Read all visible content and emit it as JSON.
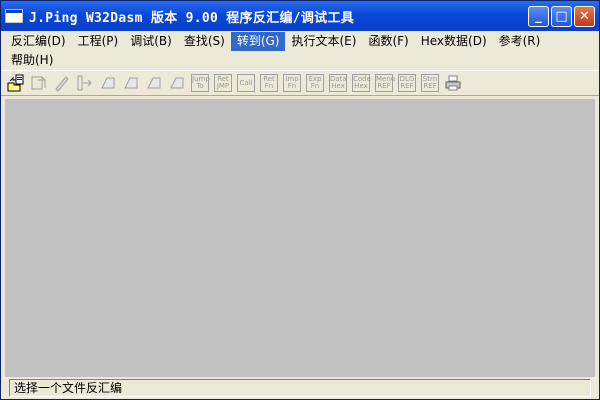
{
  "window": {
    "title": "J.Ping W32Dasm 版本 9.00 程序反汇编/调试工具",
    "buttons": {
      "minimize": "_",
      "maximize": "□",
      "close": "✕"
    }
  },
  "menu": [
    {
      "label": "反汇编(D)"
    },
    {
      "label": "工程(P)"
    },
    {
      "label": "调试(B)"
    },
    {
      "label": "查找(S)"
    },
    {
      "label": "转到(G)",
      "active": true
    },
    {
      "label": "执行文本(E)"
    },
    {
      "label": "函数(F)"
    },
    {
      "label": "Hex数据(D)"
    },
    {
      "label": "参考(R)"
    },
    {
      "label": "帮助(H)"
    }
  ],
  "toolbar": {
    "text_buttons": {
      "jump_to": [
        "Jump",
        "To"
      ],
      "ret_jmp": [
        "Ret",
        "JMP"
      ],
      "call": [
        "Call",
        ""
      ],
      "ret_fn": [
        "Ret",
        "Fn"
      ],
      "imp_fn": [
        "Imp",
        "Fn"
      ],
      "exp_fn": [
        "Exp",
        "Fn"
      ],
      "data_hex": [
        "Data",
        "Hex"
      ],
      "code_hex": [
        "Code",
        "Hex"
      ],
      "menu_ref": [
        "Menu",
        "REF"
      ],
      "dlg_ref": [
        "DLG",
        "REF"
      ],
      "strn_ref": [
        "Strn",
        "REF"
      ]
    }
  },
  "status": {
    "text": "选择一个文件反汇编"
  },
  "colors": {
    "titlebar": "#0a48d8",
    "client": "#c0c0c0",
    "menu_active": "#316ac5"
  }
}
